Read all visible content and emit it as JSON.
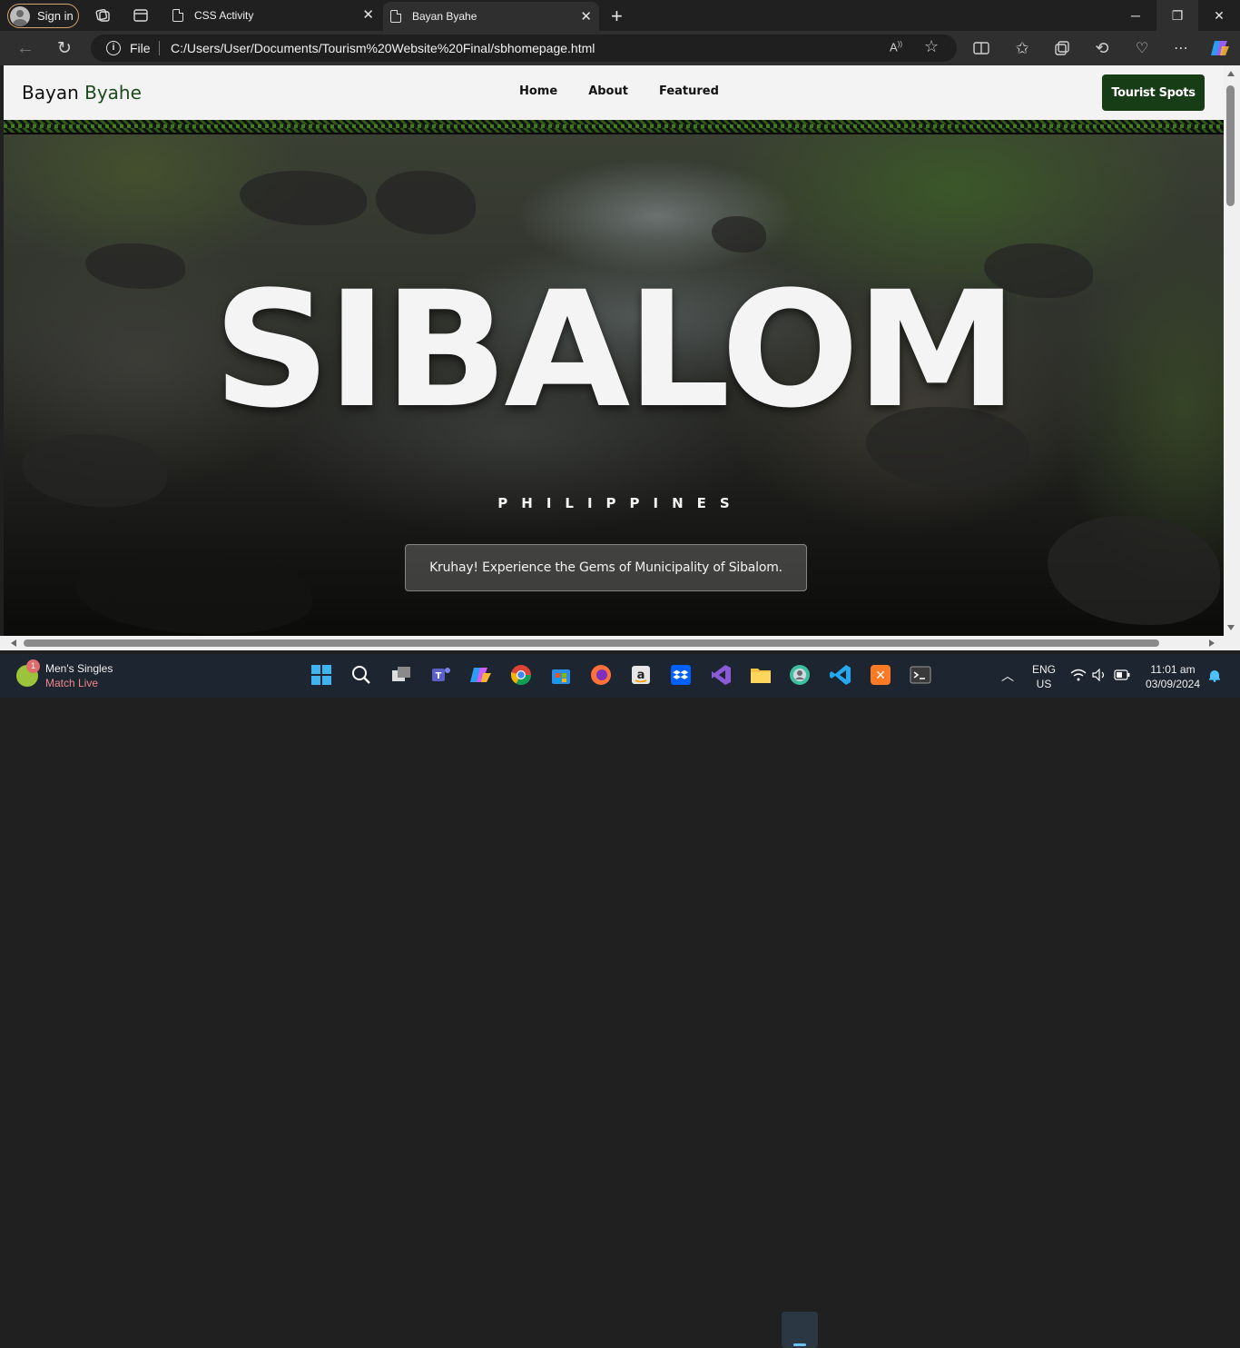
{
  "browser": {
    "signin_label": "Sign in",
    "tabs": [
      {
        "title": "CSS Activity",
        "active": false
      },
      {
        "title": "Bayan Byahe",
        "active": true
      }
    ],
    "address": {
      "scheme_label": "File",
      "url": "C:/Users/User/Documents/Tourism%20Website%20Final/sbhomepage.html"
    }
  },
  "site": {
    "brand_part1": "Bayan",
    "brand_part2": "Byahe",
    "nav": [
      "Home",
      "About",
      "Featured"
    ],
    "cta_label": "Tourist Spots",
    "hero_title": "SIBALOM",
    "hero_subtitle": "PHILIPPINES",
    "hero_tagline": "Kruhay! Experience the Gems of Municipality of Sibalom."
  },
  "taskbar": {
    "news_badge": "1",
    "news_title": "Men's Singles",
    "news_subtitle": "Match Live",
    "lang_top": "ENG",
    "lang_bottom": "US",
    "time": "11:01 am",
    "date": "03/09/2024"
  },
  "colors": {
    "brand_green": "#1c4a1a",
    "cta_bg": "#173d16",
    "browser_bg": "#202020",
    "taskbar_bg": "#1c2530"
  }
}
